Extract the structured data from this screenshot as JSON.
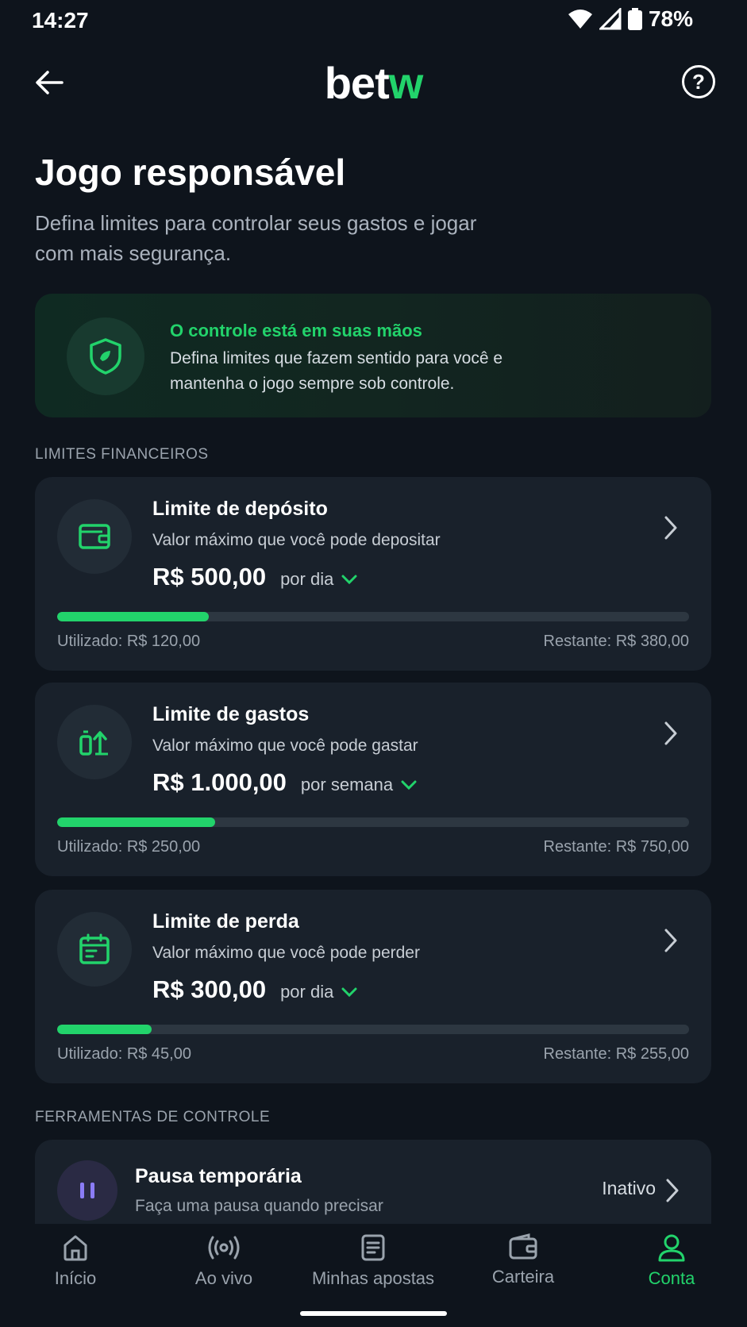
{
  "status_bar": {
    "time": "14:27",
    "battery": "78%"
  },
  "header": {
    "logo_main": "bet",
    "logo_accent": "w",
    "help_label": "?"
  },
  "page": {
    "title": "Jogo responsável",
    "subtitle": "Defina limites para controlar seus gastos e jogar com mais segurança."
  },
  "banner": {
    "title": "O controle está em suas mãos",
    "text": "Defina limites que fazem sentido para você e mantenha o jogo sempre sob controle."
  },
  "sections": {
    "financial": "LIMITES FINANCEIROS",
    "tools": "FERRAMENTAS DE CONTROLE"
  },
  "limits": [
    {
      "title": "Limite de depósito",
      "description": "Valor máximo que você pode depositar",
      "amount": "R$ 500,00",
      "period": "por dia",
      "used": "Utilizado: R$ 120,00",
      "remaining": "Restante: R$ 380,00",
      "progress": 0.24
    },
    {
      "title": "Limite de gastos",
      "description": "Valor máximo que você pode gastar",
      "amount": "R$ 1.000,00",
      "period": "por semana",
      "used": "Utilizado: R$ 250,00",
      "remaining": "Restante: R$ 750,00",
      "progress": 0.25
    },
    {
      "title": "Limite de perda",
      "description": "Valor máximo que você pode perder",
      "amount": "R$ 300,00",
      "period": "por dia",
      "used": "Utilizado: R$ 45,00",
      "remaining": "Restante: R$ 255,00",
      "progress": 0.15
    }
  ],
  "pause": {
    "title": "Pausa temporária",
    "description": "Faça uma pausa quando precisar",
    "status": "Inativo"
  },
  "nav": [
    {
      "label": "Início",
      "icon": "home-icon"
    },
    {
      "label": "Ao vivo",
      "icon": "live-icon"
    },
    {
      "label": "Minhas apostas",
      "icon": "bets-icon"
    },
    {
      "label": "Carteira",
      "icon": "wallet-icon"
    },
    {
      "label": "Conta",
      "icon": "account-icon"
    }
  ],
  "colors": {
    "accent": "#22d36b",
    "background": "#0e141c",
    "card": "#19212b",
    "pause_accent": "#8b7cf6"
  }
}
